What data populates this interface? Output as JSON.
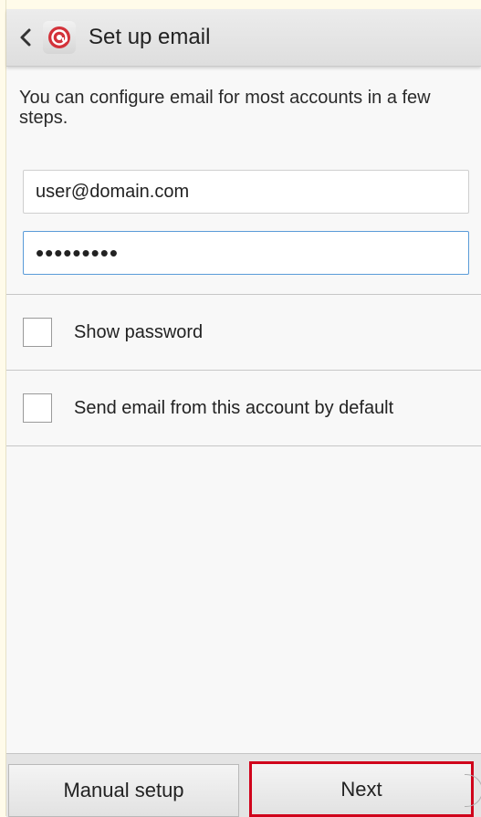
{
  "header": {
    "title": "Set up email",
    "back_icon": "chevron-left-icon",
    "app_icon": "email-app-icon",
    "accent": "#d3323a"
  },
  "intro": {
    "text": "You can configure email for most accounts in a few steps."
  },
  "form": {
    "email_value": "user@domain.com",
    "password_value": "•••••••••"
  },
  "options": [
    {
      "label": "Show password",
      "checked": false
    },
    {
      "label": "Send email from this account by default",
      "checked": false
    }
  ],
  "footer": {
    "manual_label": "Manual setup",
    "next_label": "Next",
    "highlight_color": "#d0021b"
  }
}
